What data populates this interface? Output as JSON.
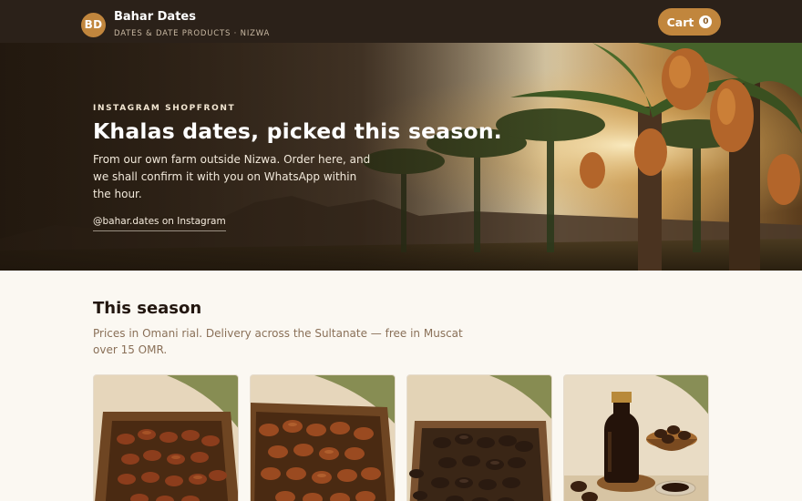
{
  "header": {
    "logo_initials": "BD",
    "brand_name": "Bahar Dates",
    "brand_sub": "DATES & DATE PRODUCTS · NIZWA",
    "cart_label": "Cart",
    "cart_count": "0",
    "brand_color": "#c1863d",
    "bar_color": "#2b2119"
  },
  "hero": {
    "eyebrow": "INSTAGRAM SHOPFRONT",
    "title": "Khalas dates, picked this season.",
    "description": "From our own farm outside Nizwa. Order here, and we shall confirm it with you on WhatsApp within the hour.",
    "instagram_link": "@bahar.dates on Instagram",
    "image": "date-palm-plantation-sunset"
  },
  "season": {
    "title": "This season",
    "description": "Prices in Omani rial. Delivery across the Sultanate — free in Muscat over 15 OMR."
  },
  "products": [
    {
      "image": "khalas-dates-wooden-tray"
    },
    {
      "image": "khalas-dates-wooden-tray-close"
    },
    {
      "image": "dark-dates-wooden-tray"
    },
    {
      "image": "date-syrup-bottle"
    }
  ]
}
